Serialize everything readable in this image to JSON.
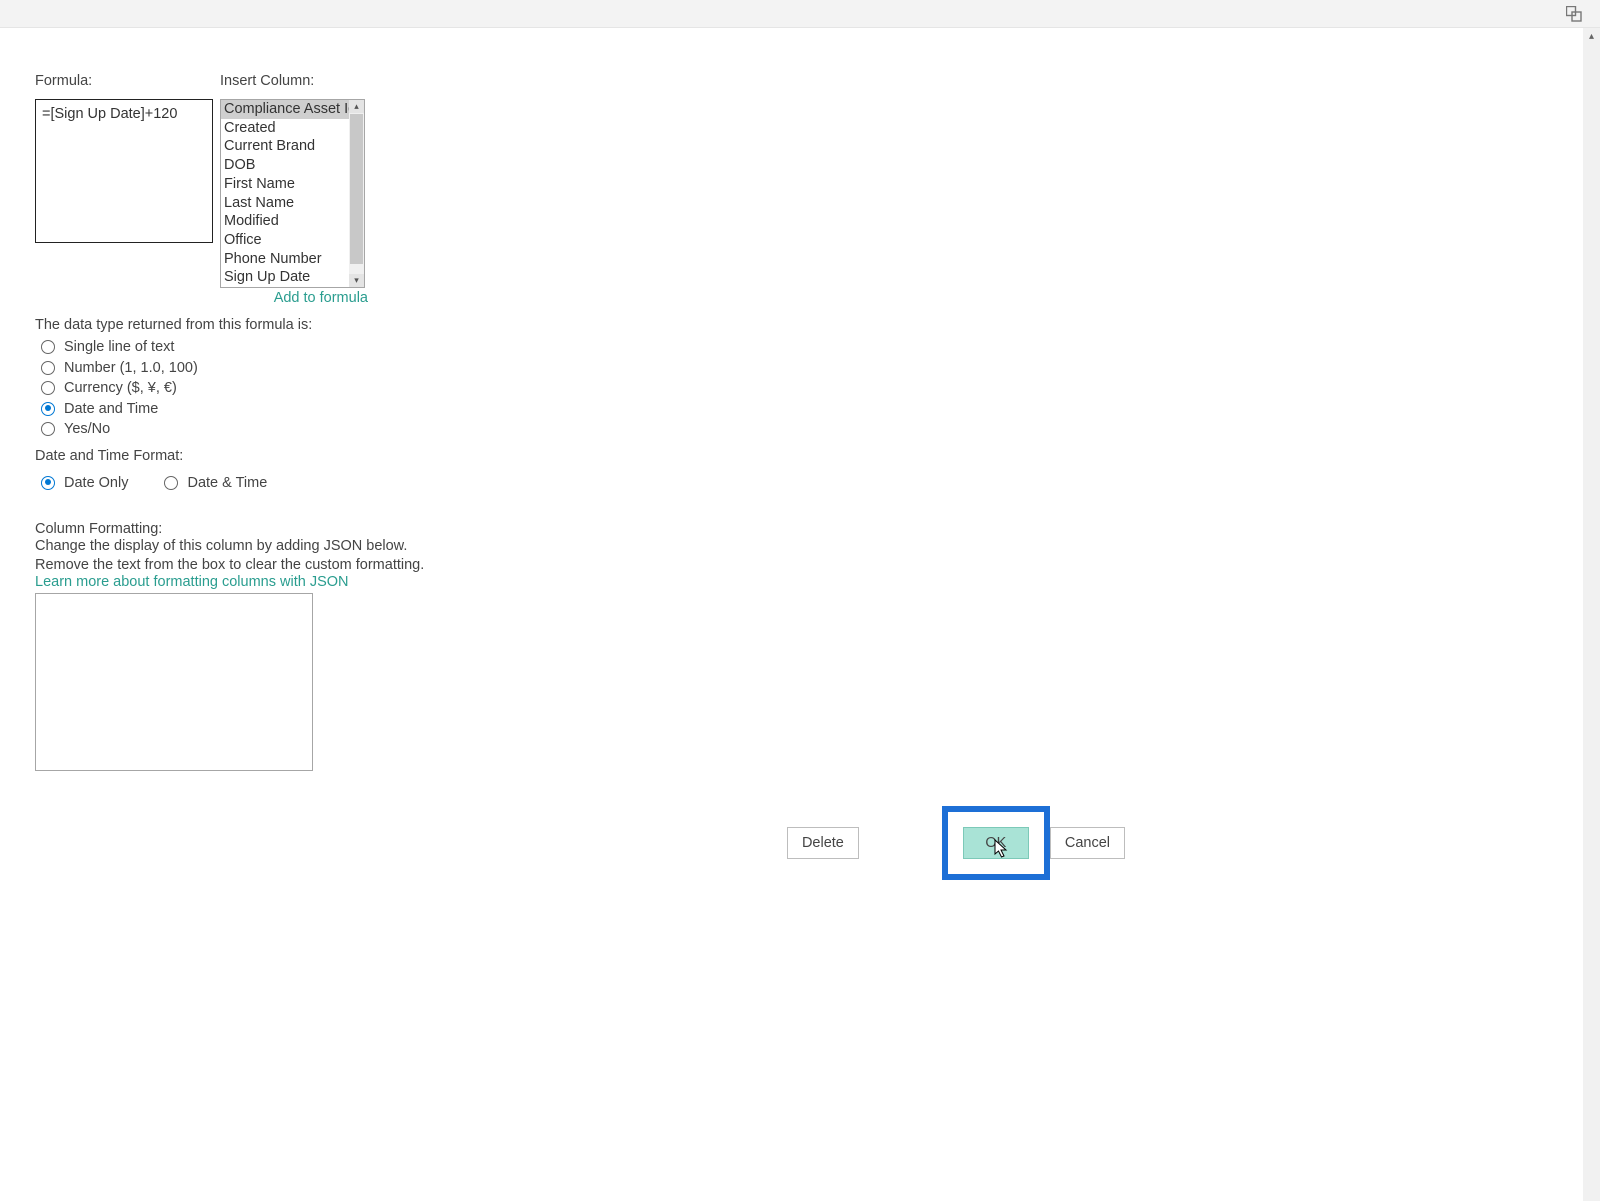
{
  "labels": {
    "formula": "Formula:",
    "insert_column": "Insert Column:",
    "add_to_formula": "Add to formula",
    "datatype_intro": "The data type returned from this formula is:",
    "dtf_label": "Date and Time Format:",
    "colfmt_label": "Column Formatting:",
    "colfmt_desc1": "Change the display of this column by adding JSON below.",
    "colfmt_desc2": "Remove the text from the box to clear the custom formatting.",
    "learn_more": "Learn more about formatting columns with JSON"
  },
  "formula_value": "=[Sign Up Date]+120",
  "columns": {
    "items": [
      "Compliance Asset Id",
      "Created",
      "Current Brand",
      "DOB",
      "First Name",
      "Last Name",
      "Modified",
      "Office",
      "Phone Number",
      "Sign Up Date"
    ],
    "selected_index": 0
  },
  "datatypes": {
    "options": [
      "Single line of text",
      "Number (1, 1.0, 100)",
      "Currency ($, ¥, €)",
      "Date and Time",
      "Yes/No"
    ],
    "selected": 3
  },
  "dtf": {
    "options": [
      "Date Only",
      "Date & Time"
    ],
    "selected": 0
  },
  "json_value": "",
  "buttons": {
    "delete": "Delete",
    "ok": "OK",
    "cancel": "Cancel"
  }
}
